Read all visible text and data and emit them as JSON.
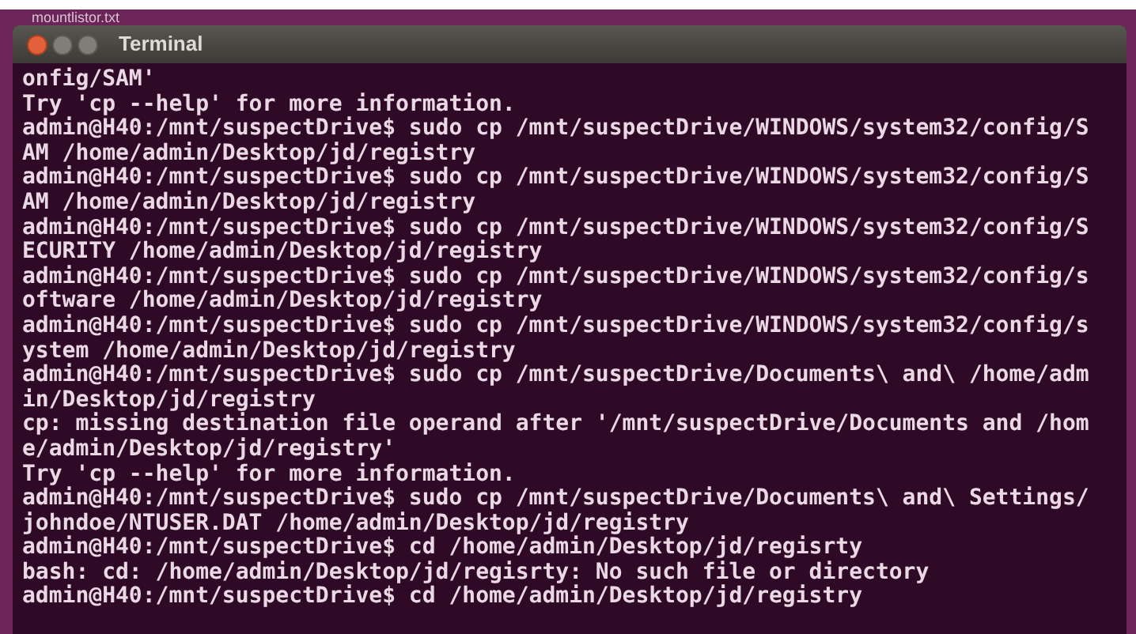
{
  "desktop": {
    "file_label": "mountlistor.txt"
  },
  "window": {
    "title": "Terminal"
  },
  "terminal_lines": [
    "onfig/SAM'",
    "Try 'cp --help' for more information.",
    "admin@H40:/mnt/suspectDrive$ sudo cp /mnt/suspectDrive/WINDOWS/system32/config/S",
    "AM /home/admin/Desktop/jd/registry",
    "admin@H40:/mnt/suspectDrive$ sudo cp /mnt/suspectDrive/WINDOWS/system32/config/S",
    "AM /home/admin/Desktop/jd/registry",
    "admin@H40:/mnt/suspectDrive$ sudo cp /mnt/suspectDrive/WINDOWS/system32/config/S",
    "ECURITY /home/admin/Desktop/jd/registry",
    "admin@H40:/mnt/suspectDrive$ sudo cp /mnt/suspectDrive/WINDOWS/system32/config/s",
    "oftware /home/admin/Desktop/jd/registry",
    "admin@H40:/mnt/suspectDrive$ sudo cp /mnt/suspectDrive/WINDOWS/system32/config/s",
    "ystem /home/admin/Desktop/jd/registry",
    "admin@H40:/mnt/suspectDrive$ sudo cp /mnt/suspectDrive/Documents\\ and\\ /home/adm",
    "in/Desktop/jd/registry",
    "cp: missing destination file operand after '/mnt/suspectDrive/Documents and /hom",
    "e/admin/Desktop/jd/registry'",
    "Try 'cp --help' for more information.",
    "admin@H40:/mnt/suspectDrive$ sudo cp /mnt/suspectDrive/Documents\\ and\\ Settings/",
    "johndoe/NTUSER.DAT /home/admin/Desktop/jd/registry",
    "admin@H40:/mnt/suspectDrive$ cd /home/admin/Desktop/jd/regisrty",
    "bash: cd: /home/admin/Desktop/jd/regisrty: No such file or directory",
    "admin@H40:/mnt/suspectDrive$ cd /home/admin/Desktop/jd/registry"
  ]
}
